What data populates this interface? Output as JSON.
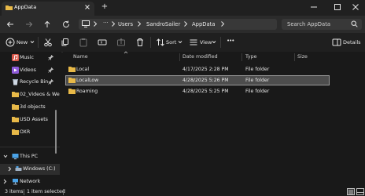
{
  "window": {
    "tab_title": "AppData",
    "new_tab_glyph": "+"
  },
  "address": {
    "breadcrumbs": [
      "Users",
      "SandroSailer",
      "AppData"
    ],
    "search_placeholder": "Search AppData"
  },
  "toolbar": {
    "new_label": "New",
    "sort_label": "Sort",
    "view_label": "View",
    "more_glyph": "•••",
    "details_label": "Details"
  },
  "sidebar": {
    "items": [
      {
        "label": "Music",
        "icon": "music-icon",
        "pinned": true
      },
      {
        "label": "Videos",
        "icon": "videos-icon",
        "pinned": true
      },
      {
        "label": "Recycle Bin",
        "icon": "recycle-bin-icon",
        "pinned": true
      },
      {
        "label": "02_Videos & We",
        "icon": "folder-icon",
        "pinned": false
      },
      {
        "label": "3d objects",
        "icon": "folder-icon",
        "pinned": false
      },
      {
        "label": "USD Assets",
        "icon": "folder-icon",
        "pinned": false
      },
      {
        "label": "OXR",
        "icon": "folder-icon",
        "pinned": false
      },
      {
        "label": "This PC",
        "icon": "pc-icon",
        "expanded": true
      },
      {
        "label": "Windows (C:)",
        "icon": "drive-icon",
        "expanded": false
      },
      {
        "label": "Network",
        "icon": "network-icon",
        "expanded": false
      }
    ]
  },
  "columns": [
    "Name",
    "Date modified",
    "Type",
    "Size"
  ],
  "files": [
    {
      "name": "Local",
      "date": "4/17/2025 2:28 PM",
      "type": "File folder",
      "size": ""
    },
    {
      "name": "LocalLow",
      "date": "4/28/2025 5:26 PM",
      "type": "File folder",
      "size": "",
      "selected": true
    },
    {
      "name": "Roaming",
      "date": "4/28/2025 5:25 PM",
      "type": "File folder",
      "size": ""
    }
  ],
  "status": {
    "items_count": "3 items",
    "selected_count": "1 item selected"
  },
  "colors": {
    "folder": "#e8b948",
    "accent": "#4cc2ff",
    "selected_row": "#4d4d4d"
  }
}
